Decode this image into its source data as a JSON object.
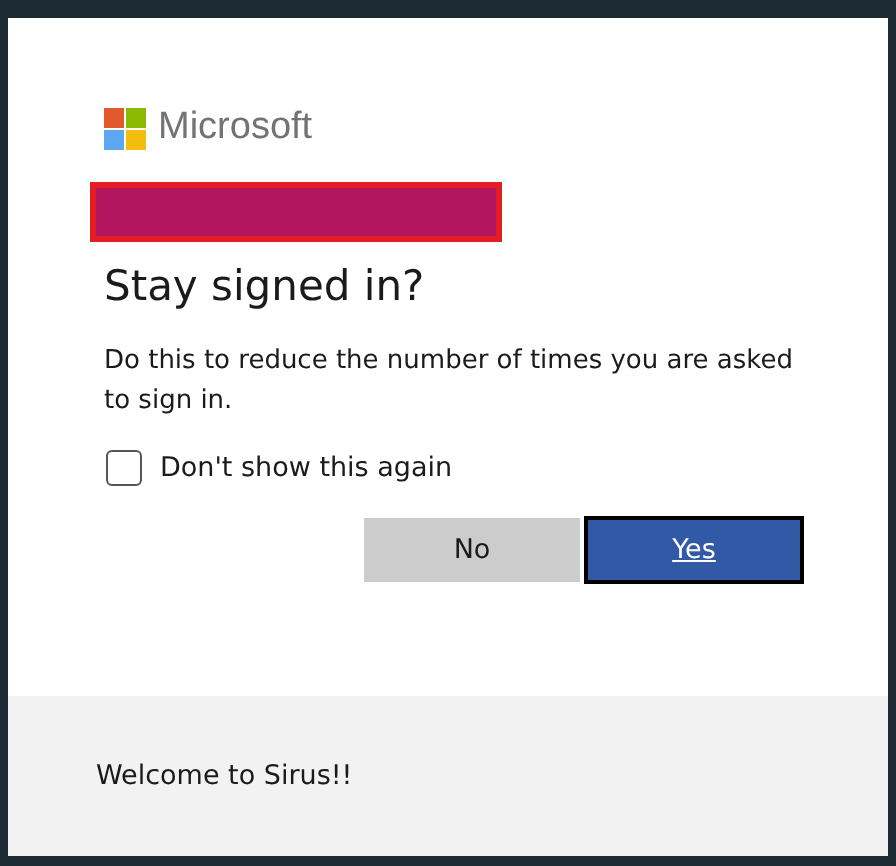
{
  "brand": {
    "name": "Microsoft"
  },
  "account": {
    "redacted": true
  },
  "title": "Stay signed in?",
  "description": "Do this to reduce the number of times you are asked to sign in.",
  "checkbox": {
    "label": "Don't show this again",
    "checked": false
  },
  "buttons": [
    {
      "label": "No",
      "kind": "secondary"
    },
    {
      "label": "Yes",
      "kind": "primary"
    }
  ],
  "footer": {
    "text": "Welcome to Sirus!!"
  }
}
